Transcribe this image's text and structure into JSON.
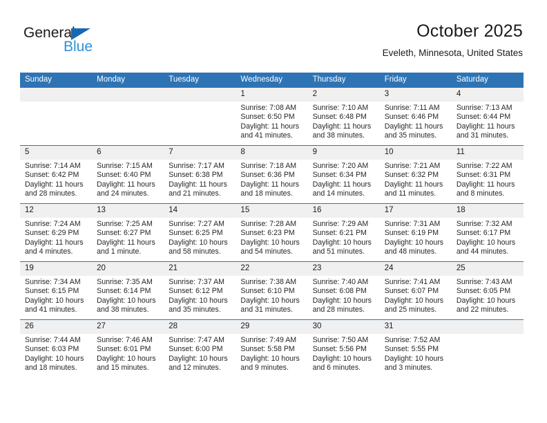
{
  "brand": {
    "name_dark": "General",
    "name_blue": "Blue",
    "accent_blue": "#2b90d9",
    "triangle_blue": "#1668b3"
  },
  "header": {
    "title": "October 2025",
    "subtitle": "Eveleth, Minnesota, United States"
  },
  "theme": {
    "header_row_bg": "#2e74b5",
    "daynum_bg": "#f0f0f0",
    "text": "#262626"
  },
  "calendar": {
    "weekday_headers": [
      "Sunday",
      "Monday",
      "Tuesday",
      "Wednesday",
      "Thursday",
      "Friday",
      "Saturday"
    ],
    "weeks": [
      [
        {
          "day": "",
          "empty": true
        },
        {
          "day": "",
          "empty": true
        },
        {
          "day": "",
          "empty": true
        },
        {
          "day": "1",
          "sunrise": "Sunrise: 7:08 AM",
          "sunset": "Sunset: 6:50 PM",
          "daylight_line1": "Daylight: 11 hours",
          "daylight_line2": "and 41 minutes."
        },
        {
          "day": "2",
          "sunrise": "Sunrise: 7:10 AM",
          "sunset": "Sunset: 6:48 PM",
          "daylight_line1": "Daylight: 11 hours",
          "daylight_line2": "and 38 minutes."
        },
        {
          "day": "3",
          "sunrise": "Sunrise: 7:11 AM",
          "sunset": "Sunset: 6:46 PM",
          "daylight_line1": "Daylight: 11 hours",
          "daylight_line2": "and 35 minutes."
        },
        {
          "day": "4",
          "sunrise": "Sunrise: 7:13 AM",
          "sunset": "Sunset: 6:44 PM",
          "daylight_line1": "Daylight: 11 hours",
          "daylight_line2": "and 31 minutes."
        }
      ],
      [
        {
          "day": "5",
          "sunrise": "Sunrise: 7:14 AM",
          "sunset": "Sunset: 6:42 PM",
          "daylight_line1": "Daylight: 11 hours",
          "daylight_line2": "and 28 minutes."
        },
        {
          "day": "6",
          "sunrise": "Sunrise: 7:15 AM",
          "sunset": "Sunset: 6:40 PM",
          "daylight_line1": "Daylight: 11 hours",
          "daylight_line2": "and 24 minutes."
        },
        {
          "day": "7",
          "sunrise": "Sunrise: 7:17 AM",
          "sunset": "Sunset: 6:38 PM",
          "daylight_line1": "Daylight: 11 hours",
          "daylight_line2": "and 21 minutes."
        },
        {
          "day": "8",
          "sunrise": "Sunrise: 7:18 AM",
          "sunset": "Sunset: 6:36 PM",
          "daylight_line1": "Daylight: 11 hours",
          "daylight_line2": "and 18 minutes."
        },
        {
          "day": "9",
          "sunrise": "Sunrise: 7:20 AM",
          "sunset": "Sunset: 6:34 PM",
          "daylight_line1": "Daylight: 11 hours",
          "daylight_line2": "and 14 minutes."
        },
        {
          "day": "10",
          "sunrise": "Sunrise: 7:21 AM",
          "sunset": "Sunset: 6:32 PM",
          "daylight_line1": "Daylight: 11 hours",
          "daylight_line2": "and 11 minutes."
        },
        {
          "day": "11",
          "sunrise": "Sunrise: 7:22 AM",
          "sunset": "Sunset: 6:31 PM",
          "daylight_line1": "Daylight: 11 hours",
          "daylight_line2": "and 8 minutes."
        }
      ],
      [
        {
          "day": "12",
          "sunrise": "Sunrise: 7:24 AM",
          "sunset": "Sunset: 6:29 PM",
          "daylight_line1": "Daylight: 11 hours",
          "daylight_line2": "and 4 minutes."
        },
        {
          "day": "13",
          "sunrise": "Sunrise: 7:25 AM",
          "sunset": "Sunset: 6:27 PM",
          "daylight_line1": "Daylight: 11 hours",
          "daylight_line2": "and 1 minute."
        },
        {
          "day": "14",
          "sunrise": "Sunrise: 7:27 AM",
          "sunset": "Sunset: 6:25 PM",
          "daylight_line1": "Daylight: 10 hours",
          "daylight_line2": "and 58 minutes."
        },
        {
          "day": "15",
          "sunrise": "Sunrise: 7:28 AM",
          "sunset": "Sunset: 6:23 PM",
          "daylight_line1": "Daylight: 10 hours",
          "daylight_line2": "and 54 minutes."
        },
        {
          "day": "16",
          "sunrise": "Sunrise: 7:29 AM",
          "sunset": "Sunset: 6:21 PM",
          "daylight_line1": "Daylight: 10 hours",
          "daylight_line2": "and 51 minutes."
        },
        {
          "day": "17",
          "sunrise": "Sunrise: 7:31 AM",
          "sunset": "Sunset: 6:19 PM",
          "daylight_line1": "Daylight: 10 hours",
          "daylight_line2": "and 48 minutes."
        },
        {
          "day": "18",
          "sunrise": "Sunrise: 7:32 AM",
          "sunset": "Sunset: 6:17 PM",
          "daylight_line1": "Daylight: 10 hours",
          "daylight_line2": "and 44 minutes."
        }
      ],
      [
        {
          "day": "19",
          "sunrise": "Sunrise: 7:34 AM",
          "sunset": "Sunset: 6:15 PM",
          "daylight_line1": "Daylight: 10 hours",
          "daylight_line2": "and 41 minutes."
        },
        {
          "day": "20",
          "sunrise": "Sunrise: 7:35 AM",
          "sunset": "Sunset: 6:14 PM",
          "daylight_line1": "Daylight: 10 hours",
          "daylight_line2": "and 38 minutes."
        },
        {
          "day": "21",
          "sunrise": "Sunrise: 7:37 AM",
          "sunset": "Sunset: 6:12 PM",
          "daylight_line1": "Daylight: 10 hours",
          "daylight_line2": "and 35 minutes."
        },
        {
          "day": "22",
          "sunrise": "Sunrise: 7:38 AM",
          "sunset": "Sunset: 6:10 PM",
          "daylight_line1": "Daylight: 10 hours",
          "daylight_line2": "and 31 minutes."
        },
        {
          "day": "23",
          "sunrise": "Sunrise: 7:40 AM",
          "sunset": "Sunset: 6:08 PM",
          "daylight_line1": "Daylight: 10 hours",
          "daylight_line2": "and 28 minutes."
        },
        {
          "day": "24",
          "sunrise": "Sunrise: 7:41 AM",
          "sunset": "Sunset: 6:07 PM",
          "daylight_line1": "Daylight: 10 hours",
          "daylight_line2": "and 25 minutes."
        },
        {
          "day": "25",
          "sunrise": "Sunrise: 7:43 AM",
          "sunset": "Sunset: 6:05 PM",
          "daylight_line1": "Daylight: 10 hours",
          "daylight_line2": "and 22 minutes."
        }
      ],
      [
        {
          "day": "26",
          "sunrise": "Sunrise: 7:44 AM",
          "sunset": "Sunset: 6:03 PM",
          "daylight_line1": "Daylight: 10 hours",
          "daylight_line2": "and 18 minutes."
        },
        {
          "day": "27",
          "sunrise": "Sunrise: 7:46 AM",
          "sunset": "Sunset: 6:01 PM",
          "daylight_line1": "Daylight: 10 hours",
          "daylight_line2": "and 15 minutes."
        },
        {
          "day": "28",
          "sunrise": "Sunrise: 7:47 AM",
          "sunset": "Sunset: 6:00 PM",
          "daylight_line1": "Daylight: 10 hours",
          "daylight_line2": "and 12 minutes."
        },
        {
          "day": "29",
          "sunrise": "Sunrise: 7:49 AM",
          "sunset": "Sunset: 5:58 PM",
          "daylight_line1": "Daylight: 10 hours",
          "daylight_line2": "and 9 minutes."
        },
        {
          "day": "30",
          "sunrise": "Sunrise: 7:50 AM",
          "sunset": "Sunset: 5:56 PM",
          "daylight_line1": "Daylight: 10 hours",
          "daylight_line2": "and 6 minutes."
        },
        {
          "day": "31",
          "sunrise": "Sunrise: 7:52 AM",
          "sunset": "Sunset: 5:55 PM",
          "daylight_line1": "Daylight: 10 hours",
          "daylight_line2": "and 3 minutes."
        },
        {
          "day": "",
          "empty": true
        }
      ]
    ]
  }
}
